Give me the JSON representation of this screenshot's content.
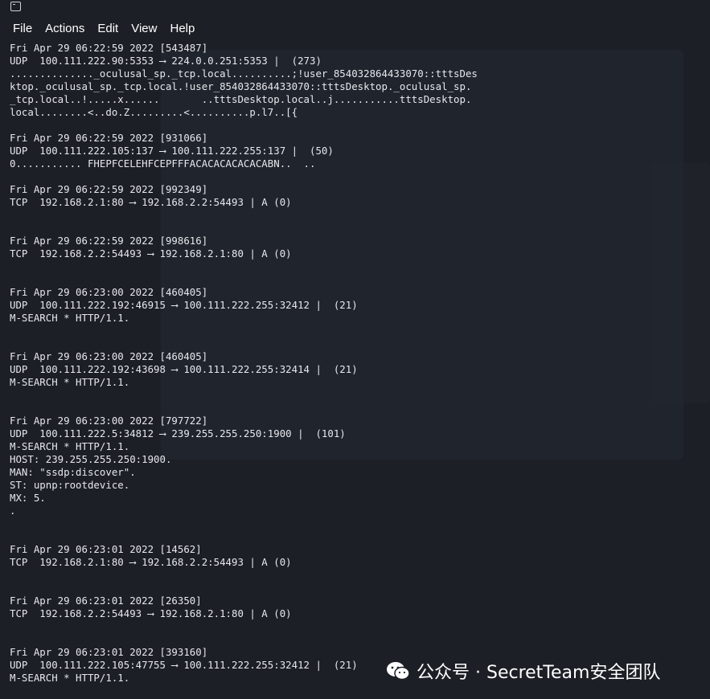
{
  "window": {
    "icon": "terminal-icon"
  },
  "menu": [
    "File",
    "Actions",
    "Edit",
    "View",
    "Help"
  ],
  "entries": [
    {
      "time": "Fri Apr 29 06:22:59 2022 [543487]",
      "proto": "UDP  100.111.222.90:5353 ⟶ 224.0.0.251:5353 |  (273)",
      "payload": [
        ".............._oculusal_sp._tcp.local..........;!user_854032864433070::tttsDes",
        "ktop._oculusal_sp._tcp.local.!user_854032864433070::tttsDesktop._oculusal_sp.",
        "_tcp.local..!.....x......       ..tttsDesktop.local..j...........tttsDesktop.",
        "local........<..do.Z.........<..........p.l7..[{"
      ],
      "gap": 1
    },
    {
      "time": "Fri Apr 29 06:22:59 2022 [931066]",
      "proto": "UDP  100.111.222.105:137 ⟶ 100.111.222.255:137 |  (50)",
      "payload": [
        "0........... FHEPFCELEHFCEPFFFACACACACACACABN..  .."
      ],
      "gap": 1
    },
    {
      "time": "Fri Apr 29 06:22:59 2022 [992349]",
      "proto": "TCP  192.168.2.1:80 ⟶ 192.168.2.2:54493 | A (0)",
      "payload": [],
      "gap": 2
    },
    {
      "time": "Fri Apr 29 06:22:59 2022 [998616]",
      "proto": "TCP  192.168.2.2:54493 ⟶ 192.168.2.1:80 | A (0)",
      "payload": [],
      "gap": 2
    },
    {
      "time": "Fri Apr 29 06:23:00 2022 [460405]",
      "proto": "UDP  100.111.222.192:46915 ⟶ 100.111.222.255:32412 |  (21)",
      "payload": [
        "M-SEARCH * HTTP/1.1."
      ],
      "gap": 2
    },
    {
      "time": "Fri Apr 29 06:23:00 2022 [460405]",
      "proto": "UDP  100.111.222.192:43698 ⟶ 100.111.222.255:32414 |  (21)",
      "payload": [
        "M-SEARCH * HTTP/1.1."
      ],
      "gap": 2
    },
    {
      "time": "Fri Apr 29 06:23:00 2022 [797722]",
      "proto": "UDP  100.111.222.5:34812 ⟶ 239.255.255.250:1900 |  (101)",
      "payload": [
        "M-SEARCH * HTTP/1.1.",
        "HOST: 239.255.255.250:1900.",
        "MAN: \"ssdp:discover\".",
        "ST: upnp:rootdevice.",
        "MX: 5.",
        "."
      ],
      "gap": 2
    },
    {
      "time": "Fri Apr 29 06:23:01 2022 [14562]",
      "proto": "TCP  192.168.2.1:80 ⟶ 192.168.2.2:54493 | A (0)",
      "payload": [],
      "gap": 2
    },
    {
      "time": "Fri Apr 29 06:23:01 2022 [26350]",
      "proto": "TCP  192.168.2.2:54493 ⟶ 192.168.2.1:80 | A (0)",
      "payload": [],
      "gap": 2
    },
    {
      "time": "Fri Apr 29 06:23:01 2022 [393160]",
      "proto": "UDP  100.111.222.105:47755 ⟶ 100.111.222.255:32412 |  (21)",
      "payload": [
        "M-SEARCH * HTTP/1.1."
      ],
      "gap": 0
    }
  ],
  "watermark": {
    "icon": "wechat-icon",
    "text": "公众号 · SecretTeam安全团队"
  },
  "colors": {
    "background": "#1c1f26",
    "text": "#e6e8ec"
  }
}
